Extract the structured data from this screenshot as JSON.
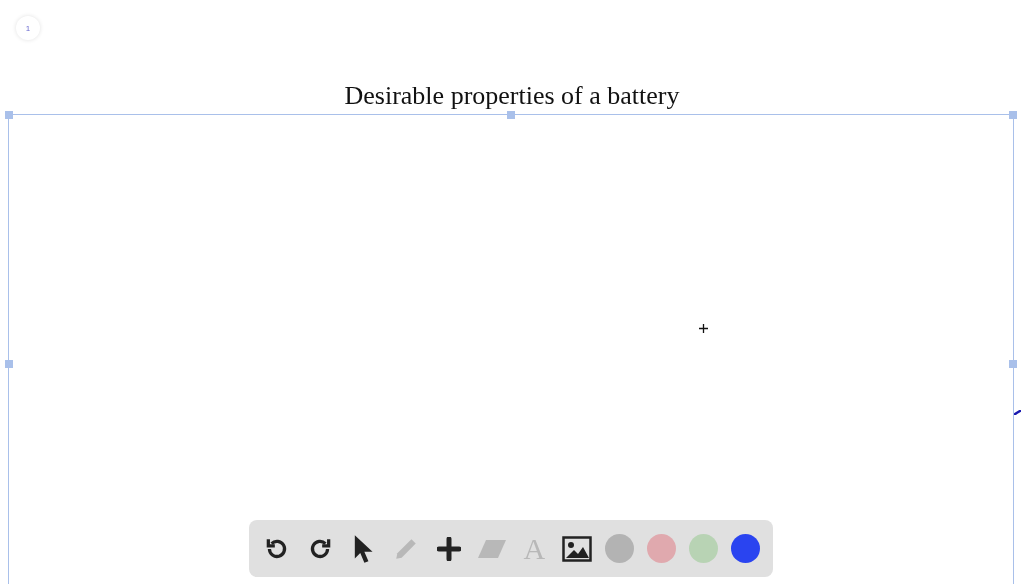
{
  "page_number": "1",
  "title": "Desirable properties of a battery",
  "toolbar": {
    "tools": [
      {
        "kind": "undo",
        "disabled": false
      },
      {
        "kind": "redo",
        "disabled": false
      },
      {
        "kind": "pointer",
        "disabled": false
      },
      {
        "kind": "pencil",
        "disabled": true
      },
      {
        "kind": "plus",
        "disabled": false
      },
      {
        "kind": "eraser",
        "disabled": true
      },
      {
        "kind": "text",
        "label": "A",
        "disabled": true
      },
      {
        "kind": "image",
        "disabled": false
      }
    ],
    "colors": [
      {
        "color": "#b3b3b3"
      },
      {
        "color": "#e0a9ae"
      },
      {
        "color": "#b8d3b4"
      },
      {
        "color": "#2a44f0"
      }
    ]
  }
}
